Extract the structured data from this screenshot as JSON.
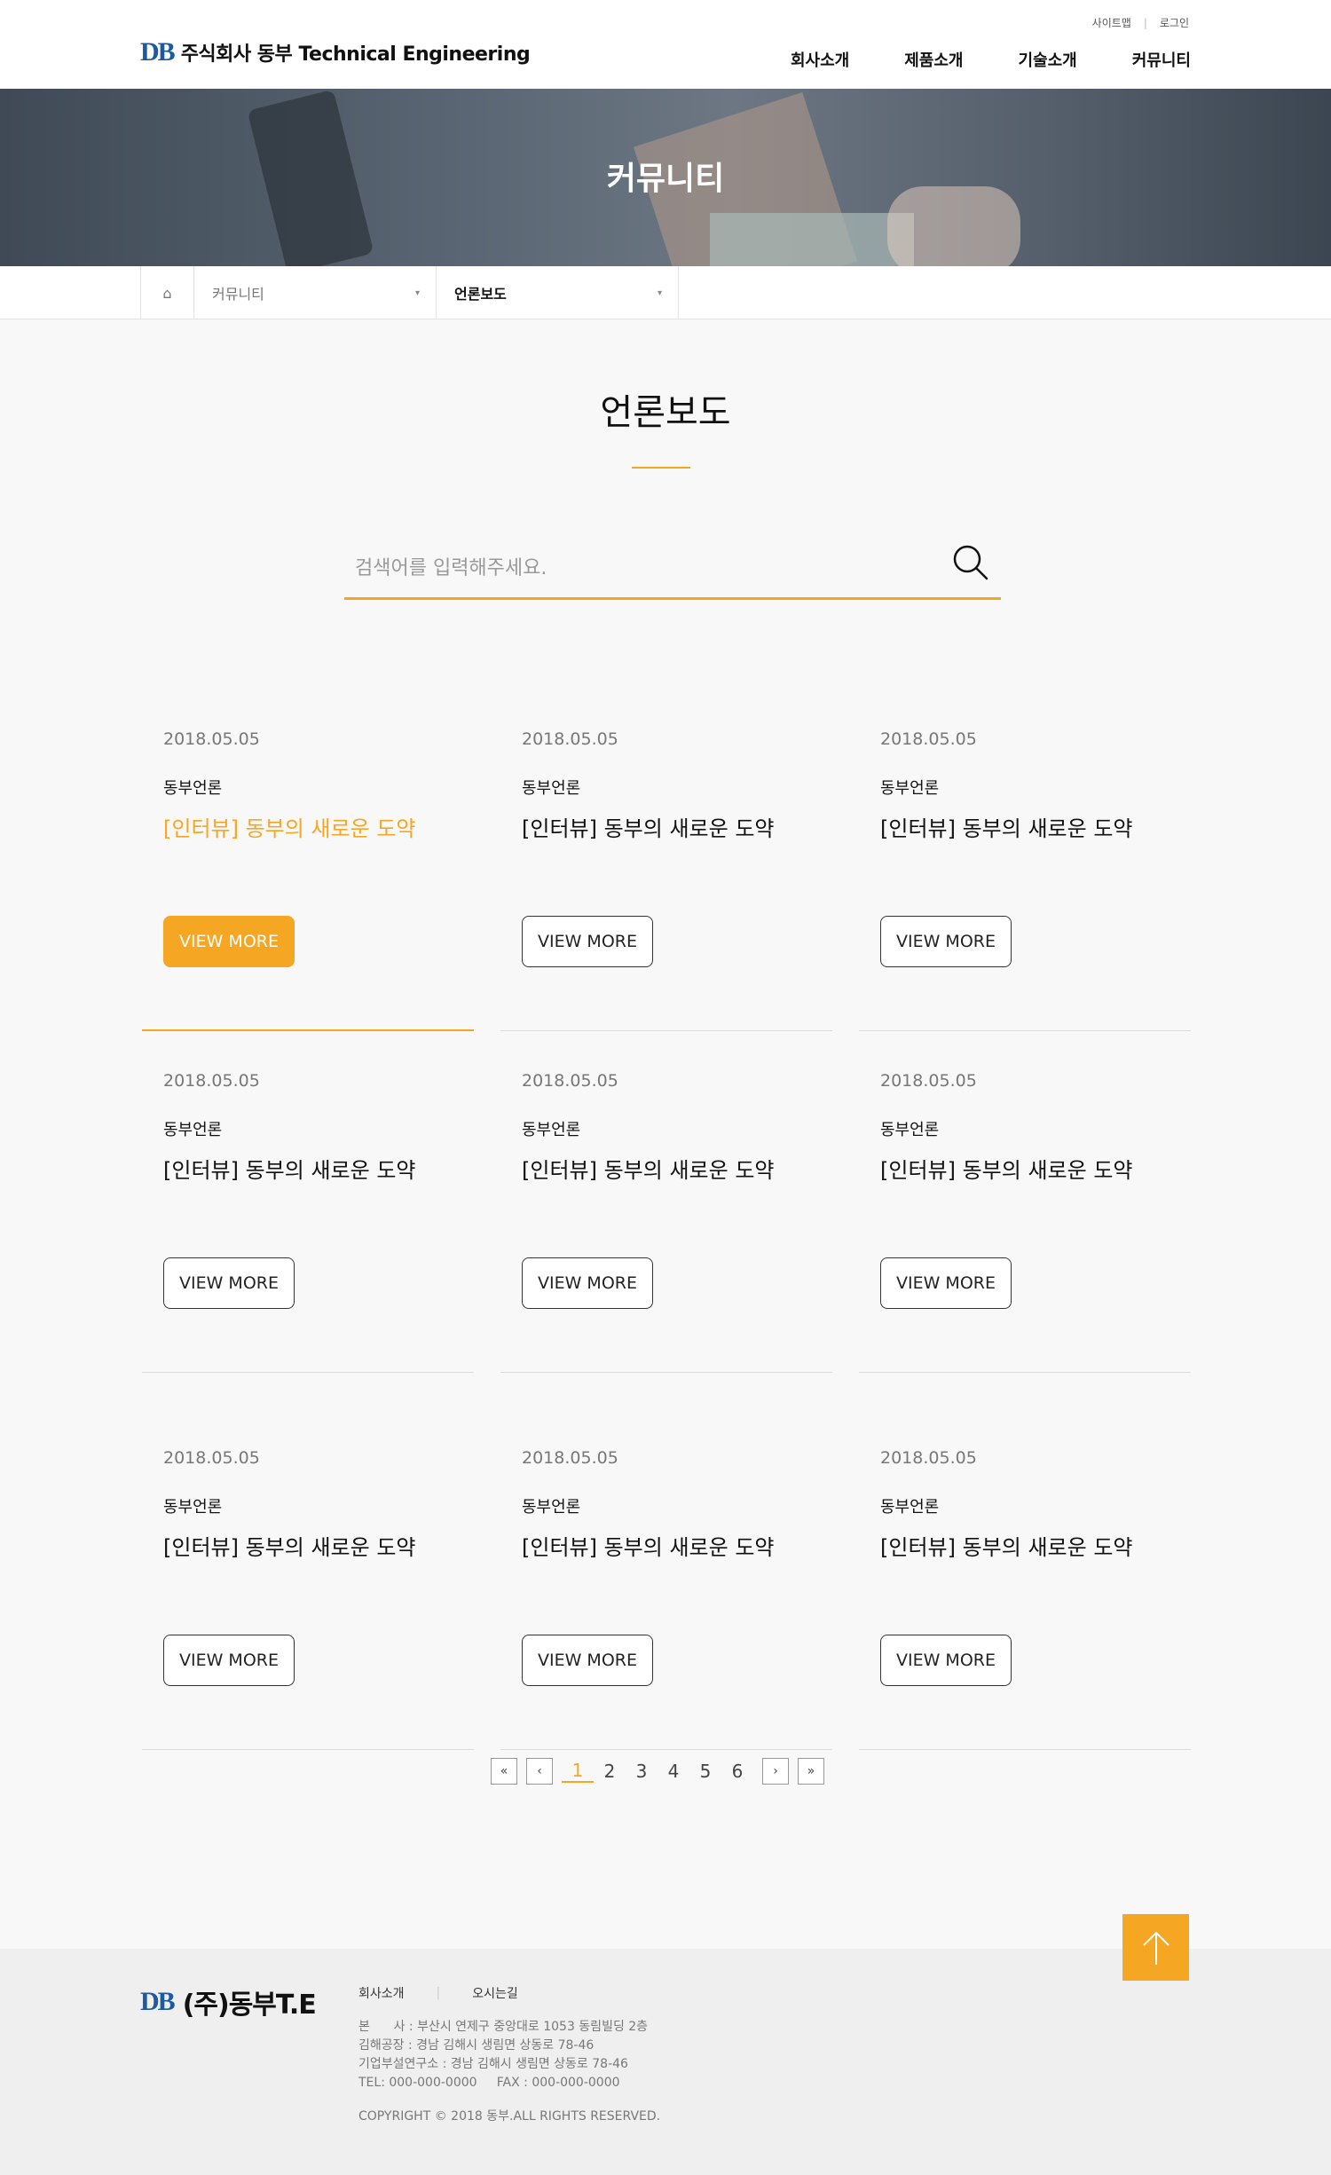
{
  "header": {
    "logo_mark": "DB",
    "logo_text": "주식회사 동부 Technical Engineering",
    "util_links": [
      "사이트맵",
      "로그인"
    ],
    "util_sep": "|",
    "nav": [
      "회사소개",
      "제품소개",
      "기술소개",
      "커뮤니티"
    ]
  },
  "banner": {
    "title": "커뮤니티"
  },
  "location": {
    "home_icon": "⌂",
    "depth1": "커뮤니티",
    "depth2": "언론보도",
    "arrow": "▾"
  },
  "page": {
    "title": "언론보도"
  },
  "search": {
    "placeholder": "검색어를 입력해주세요."
  },
  "cards": [
    {
      "date": "2018.05.05",
      "category": "동부언론",
      "title": "[인터뷰] 동부의 새로운 도약",
      "button": "VIEW MORE"
    },
    {
      "date": "2018.05.05",
      "category": "동부언론",
      "title": "[인터뷰] 동부의 새로운 도약",
      "button": "VIEW MORE"
    },
    {
      "date": "2018.05.05",
      "category": "동부언론",
      "title": "[인터뷰] 동부의 새로운 도약",
      "button": "VIEW MORE"
    },
    {
      "date": "2018.05.05",
      "category": "동부언론",
      "title": "[인터뷰] 동부의 새로운 도약",
      "button": "VIEW MORE"
    },
    {
      "date": "2018.05.05",
      "category": "동부언론",
      "title": "[인터뷰] 동부의 새로운 도약",
      "button": "VIEW MORE"
    },
    {
      "date": "2018.05.05",
      "category": "동부언론",
      "title": "[인터뷰] 동부의 새로운 도약",
      "button": "VIEW MORE"
    },
    {
      "date": "2018.05.05",
      "category": "동부언론",
      "title": "[인터뷰] 동부의 새로운 도약",
      "button": "VIEW MORE"
    },
    {
      "date": "2018.05.05",
      "category": "동부언론",
      "title": "[인터뷰] 동부의 새로운 도약",
      "button": "VIEW MORE"
    },
    {
      "date": "2018.05.05",
      "category": "동부언론",
      "title": "[인터뷰] 동부의 새로운 도약",
      "button": "VIEW MORE"
    }
  ],
  "pagination": {
    "first": "«",
    "prev": "‹",
    "next": "›",
    "last": "»",
    "pages": [
      "1",
      "2",
      "3",
      "4",
      "5",
      "6"
    ],
    "current": "1"
  },
  "footer": {
    "logo_mark": "DB",
    "logo_text": "(주)동부T.E",
    "links": [
      "회사소개",
      "오시는길"
    ],
    "link_sep": "|",
    "info": [
      "본      사 : 부산시 연제구 중앙대로 1053 동림빌딩 2층",
      "김해공장 : 경남 김해시 생림면 상동로 78-46",
      "기업부설연구소 : 경남 김해시 생림면 상동로 78-46",
      "TEL: 000-000-0000     FAX : 000-000-0000"
    ],
    "copyright": "COPYRIGHT © 2018 동부.ALL RIGHTS RESERVED."
  },
  "colors": {
    "accent": "#f5a623",
    "brand": "#1d5aa0"
  }
}
